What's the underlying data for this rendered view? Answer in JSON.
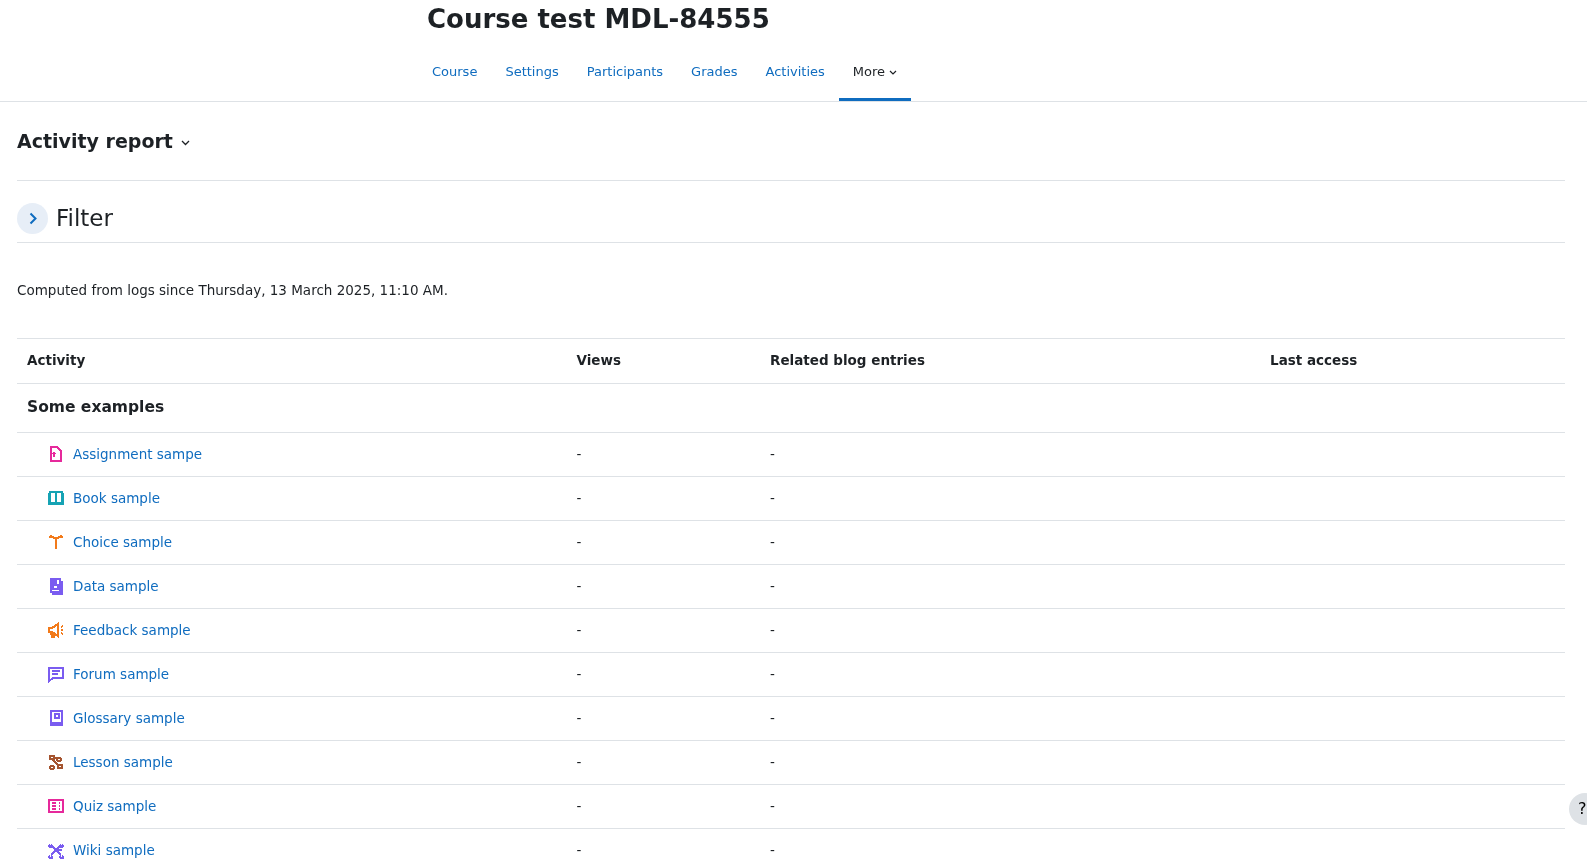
{
  "course_title": "Course test MDL-84555",
  "tabs": [
    {
      "label": "Course",
      "selected": false
    },
    {
      "label": "Settings",
      "selected": false
    },
    {
      "label": "Participants",
      "selected": false
    },
    {
      "label": "Grades",
      "selected": false
    },
    {
      "label": "Activities",
      "selected": false
    },
    {
      "label": "More",
      "selected": true
    }
  ],
  "page_heading": "Activity report",
  "filter": {
    "title": "Filter",
    "expanded": false
  },
  "computed_note": "Computed from logs since Thursday, 13 March 2025, 11:10 AM.",
  "table": {
    "columns": [
      "Activity",
      "Views",
      "Related blog entries",
      "Last access"
    ],
    "section": "Some examples",
    "rows": [
      {
        "kind": "assignment",
        "color": "#e6299b",
        "activity": "Assignment sampe",
        "views": "-",
        "blog_entries": "-"
      },
      {
        "kind": "book",
        "color": "#16a3b4",
        "activity": "Book sample",
        "views": "-",
        "blog_entries": "-"
      },
      {
        "kind": "choice",
        "color": "#f27a1a",
        "activity": "Choice sample",
        "views": "-",
        "blog_entries": "-"
      },
      {
        "kind": "data",
        "color": "#7a5cf0",
        "activity": "Data sample",
        "views": "-",
        "blog_entries": "-"
      },
      {
        "kind": "feedback",
        "color": "#f27a1a",
        "activity": "Feedback sample",
        "views": "-",
        "blog_entries": "-"
      },
      {
        "kind": "forum",
        "color": "#7a5cf0",
        "activity": "Forum sample",
        "views": "-",
        "blog_entries": "-"
      },
      {
        "kind": "glossary",
        "color": "#7a5cf0",
        "activity": "Glossary sample",
        "views": "-",
        "blog_entries": "-"
      },
      {
        "kind": "lesson",
        "color": "#a5542f",
        "activity": "Lesson sample",
        "views": "-",
        "blog_entries": "-"
      },
      {
        "kind": "quiz",
        "color": "#e6299b",
        "activity": "Quiz sample",
        "views": "-",
        "blog_entries": "-"
      },
      {
        "kind": "wiki",
        "color": "#7a5cf0",
        "activity": "Wiki sample",
        "views": "-",
        "blog_entries": "-"
      }
    ]
  },
  "help_button": "?"
}
